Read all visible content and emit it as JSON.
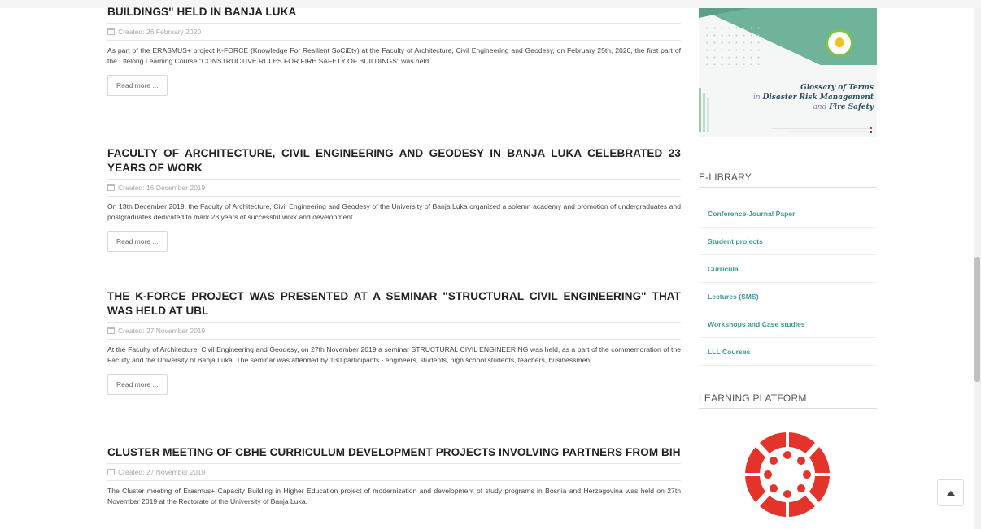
{
  "articles": [
    {
      "title": "BUILDINGS\" HELD IN BANJA LUKA",
      "created": "Created: 26 February 2020",
      "intro": "As part of the ERASMUS+ project K-FORCE (Knowledge For Resilient SoCiEty) at the Faculty of Architecture, Civil Engineering and Geodesy, on February 25th, 2020, the first part of the Lifelong Learning Course \"CONSTRUCTIVE RULES FOR FIRE SAFETY OF BUILDINGS\" was held.",
      "read_more": "Read more ..."
    },
    {
      "title": "FACULTY OF ARCHITECTURE, CIVIL ENGINEERING AND GEODESY IN BANJA LUKA CELEBRATED 23 YEARS OF WORK",
      "created": "Created: 16 December 2019",
      "intro": "On 13th December 2019, the Faculty of Architecture, Civil Engineering and Geodesy of the University of Banja Luka organized a solemn academy and promotion of undergraduates and postgraduates dedicated to mark 23 years of successful work and development.",
      "read_more": "Read more ..."
    },
    {
      "title": "THE K-FORCE PROJECT WAS PRESENTED AT A SEMINAR \"STRUCTURAL CIVIL ENGINEERING\" THAT WAS HELD AT UBL",
      "created": "Created: 27 November 2019",
      "intro": "At the Faculty of Architecture, Civil Engineering and Geodesy, on 27th November 2019 a seminar STRUCTURAL CIVIL ENGINEERING was held, as a part of the commemoration of the Faculty and the University of Banja Luka. The seminar was attended by 130 participants - engineers, students, high school students, teachers, businessmen...",
      "read_more": "Read more ..."
    },
    {
      "title": "CLUSTER MEETING OF CBHE CURRICULUM DEVELOPMENT PROJECTS INVOLVING PARTNERS FROM BIH",
      "created": "Created: 27 November 2019",
      "intro": "The Cluster meeting of Erasmus+ Capacity Building in Higher Education project of modernization and development of study programs in Bosnia and Herzegovina was held on 27th November 2019 at the Rectorate of the University of Banja Luka."
    }
  ],
  "banner": {
    "line1": "Glossary of Terms",
    "line2a": "in ",
    "line2b": "Disaster Risk Management",
    "line3a": "and ",
    "line3b": "Fire Safety"
  },
  "elibrary": {
    "title": "E-LIBRARY",
    "items": [
      "Conference-Journal Paper",
      "Student projects",
      "Curricula",
      "Lectures (SMS)",
      "Workshops and Case studies",
      "LLL Courses"
    ]
  },
  "learning_platform": {
    "title": "LEARNING PLATFORM"
  },
  "colors": {
    "accent": "#3a9b8f",
    "logo_red": "#e4332a",
    "banner_green": "#6fb39b"
  },
  "icons": {
    "calendar": "calendar-icon",
    "to_top": "arrow-up-icon",
    "logo": "canvas-logo"
  }
}
